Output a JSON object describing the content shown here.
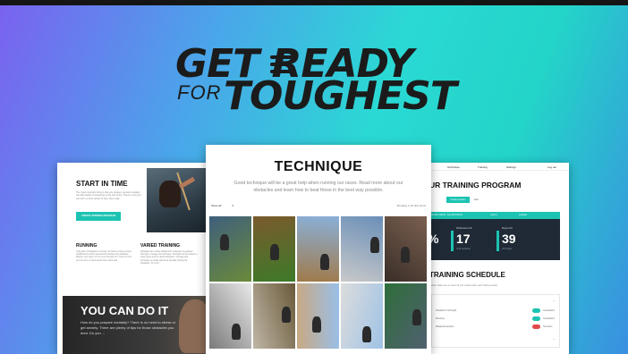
{
  "logo": {
    "line1": "GET READY",
    "for": "FOR",
    "line2": "TOUGHEST"
  },
  "left_panel": {
    "title": "START IN TIME",
    "intro": "The most important thing is that you prepare yourself mentally. Get fully aware of preparing to the end of the. There is a lot you can do in a short period of time. Don't wait.",
    "button": "CREATE TRAINING PROGRAM",
    "running_title": "RUNNING",
    "running_text": "A big part of Toughest is running. So when running is done, Vestibulum bi auctor elementum between the obstacles. Monitor your heart, run for over the beat of it. There is a lot you can do in a short period time. Dont wait.",
    "varied_title": "VARIED TRAINING",
    "varied_text": "Obstacles are mainly divided into 3 aspects: by-passed Strength, courage and technique. Strength can be trained in many ways and for varied obstacles. Courage and technique is mostly gained by actually training the obstacles. Try it out.",
    "dark_title": "YOU CAN DO IT",
    "dark_text": "How do you prepare mentally? There is no need to stress or get anxiety. There are plenty of tips for those obstacles you dont. Do you ..."
  },
  "center_panel": {
    "title": "TECHNIQUE",
    "subtitle": "Good technique will be a great help when running our races. Read more about our obstacles and learn how to beat these in the best way possible.",
    "filter_label": "Show all",
    "showing": "Showing 1-16 (32) items",
    "tiles": [
      {
        "c1": "#3f5f7d",
        "c2": "#6a8a3a"
      },
      {
        "c1": "#7a5a2c",
        "c2": "#3d7a2a"
      },
      {
        "c1": "#8ab0d8",
        "c2": "#a07a4a"
      },
      {
        "c1": "#6a8fb8",
        "c2": "#c9c9c9"
      },
      {
        "c1": "#7a6050",
        "c2": "#3a2e28"
      },
      {
        "c1": "#e8e8e8",
        "c2": "#7a7a7a"
      },
      {
        "c1": "#6a5a3a",
        "c2": "#bfb6a6"
      },
      {
        "c1": "#99bfe8",
        "c2": "#c9a882"
      },
      {
        "c1": "#9fc3e6",
        "c2": "#dcdcdc"
      },
      {
        "c1": "#506070",
        "c2": "#2e6e3a"
      }
    ]
  },
  "right_panel": {
    "nav": [
      "Technique",
      "Training",
      "Settings",
      "Log out"
    ],
    "title": "UR TRAINING PROGRAM",
    "btn_primary": "Create program",
    "btn_secondary": "Next",
    "strip": [
      "Wed 2017-08-01 - Tue 2017-08-31",
      "Level 1",
      "Location"
    ],
    "stats": [
      {
        "label": "",
        "value": "%",
        "sub": ""
      },
      {
        "label": "Workouts left",
        "value": "17",
        "sub": "of 24 workouts"
      },
      {
        "label": "Days left",
        "value": "39",
        "sub": "of 60 days"
      }
    ],
    "schedule_title": "TRAINING SCHEDULE",
    "schedule_text": "edule. Make sure to check off your workout after each training session",
    "rows": [
      {
        "name": "Obstacle & Strength",
        "status": "Completed",
        "on": true
      },
      {
        "name": "Running",
        "status": "Completed",
        "on": true
      },
      {
        "name": "Weekend session",
        "status": "Not done",
        "on": false
      }
    ]
  },
  "colors": {
    "accent": "#1cc3b2",
    "dark": "#1f2a36",
    "bg_start": "#7a62f0",
    "bg_end": "#23d4c8"
  }
}
